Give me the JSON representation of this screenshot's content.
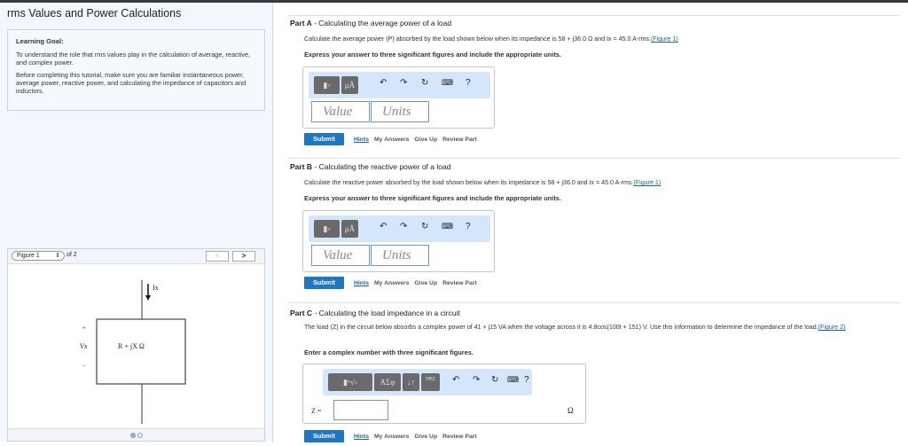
{
  "title": "rms Values and Power Calculations",
  "goal": {
    "heading": "Learning Goal:",
    "p1": "To understand the role that rms values play in the calculation of average, reactive, and complex power.",
    "p2": "Before completing this tutorial, make sure you are familiar instantaneous power, average power, reactive power, and calculating the impedance of capacitors and inductors."
  },
  "figure": {
    "select": "Figure 1",
    "of": "of 2",
    "prev": "<",
    "next": ">",
    "current_label": "Ix",
    "impedance": "R + jX Ω",
    "voltage": "Vx",
    "plus": "+",
    "minus": "−"
  },
  "actions": {
    "submit": "Submit",
    "hints": "Hints",
    "my_answers": "My Answers",
    "give_up": "Give Up",
    "review": "Review Part"
  },
  "toolbar": {
    "units_btn": "μÅ",
    "greek": "AΣφ",
    "arrows": "↓↑",
    "vec": "vec",
    "help": "?"
  },
  "parts": [
    {
      "label": "Part A",
      "title": " - Calculating the average power of a load",
      "question": "Calculate the average power (P) absorbed by the load shown below when its impedance is 58 + j36.0 Ω and Ix = 45.0 A-rms.",
      "link": "(Figure 1)",
      "instruction": "Express your answer to three significant figures and include the appropriate units.",
      "value_ph": "Value",
      "units_ph": "Units"
    },
    {
      "label": "Part B",
      "title": " - Calculating the reactive power of a load",
      "question": "Calculate the reactive power absorbed by the load shown below when its impedance is 58 + j36.0 and Ix = 45.0 A-rms.",
      "link": "(Figure 1)",
      "instruction": "Express your answer to three significant figures and include the appropriate units.",
      "value_ph": "Value",
      "units_ph": "Units"
    },
    {
      "label": "Part C",
      "title": " - Calculating the load impedance in a circuit",
      "question": "The load (Z) in the circuit below absorbs a complex power of 41 + j15 VA when the voltage across it is 4.8cos(100t + 151) V. Use this information to determine the impedance of the load.",
      "link": "(Figure 2)",
      "instruction": "Enter a complex number with three significant figures.",
      "var": "Z =",
      "unit": "Ω"
    }
  ]
}
